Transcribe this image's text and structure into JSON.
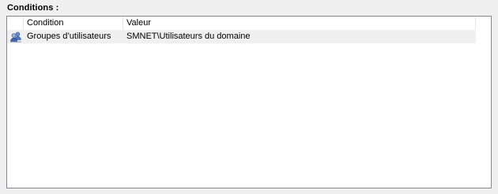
{
  "section": {
    "label": "Conditions :"
  },
  "table": {
    "columns": [
      "",
      "Condition",
      "Valeur"
    ],
    "rows": [
      {
        "icon": "users-group-icon",
        "condition": "Groupes d’utilisateurs",
        "value": "SMNET\\Utilisateurs du domaine"
      }
    ]
  }
}
